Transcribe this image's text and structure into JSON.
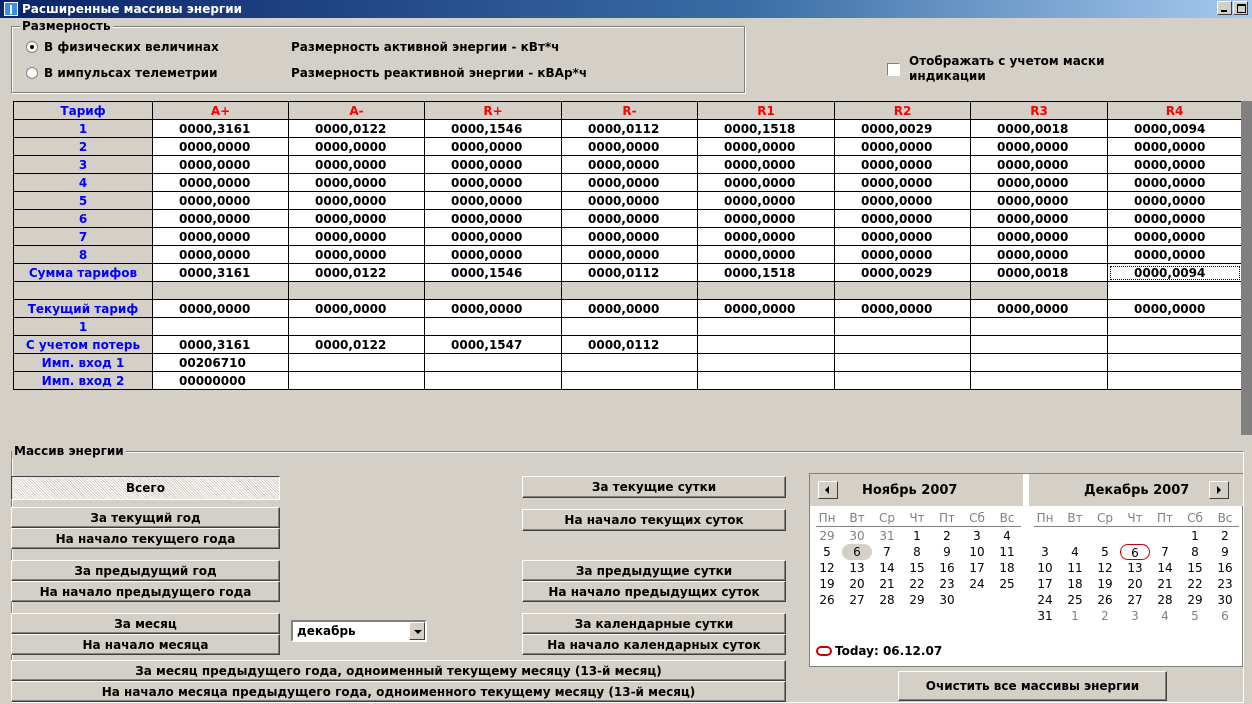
{
  "window": {
    "title": "Расширенные массивы энергии"
  },
  "dimension": {
    "legend": "Размерность",
    "option_physical": "В физических величинах",
    "option_pulses": "В импульсах телеметрии",
    "active_unit": "Размерность активной энергии - кВт*ч",
    "reactive_unit": "Размерность реактивной энергии - кВАр*ч",
    "mask_checkbox_line1": "Отображать с учетом маски",
    "mask_checkbox_line2": "индикации",
    "mask_checked": false
  },
  "grid": {
    "headers": [
      "Тариф",
      "A+",
      "A-",
      "R+",
      "R-",
      "R1",
      "R2",
      "R3",
      "R4"
    ],
    "rows": [
      {
        "label": "1",
        "cells": [
          "0000,3161",
          "0000,0122",
          "0000,1546",
          "0000,0112",
          "0000,1518",
          "0000,0029",
          "0000,0018",
          "0000,0094"
        ]
      },
      {
        "label": "2",
        "cells": [
          "0000,0000",
          "0000,0000",
          "0000,0000",
          "0000,0000",
          "0000,0000",
          "0000,0000",
          "0000,0000",
          "0000,0000"
        ]
      },
      {
        "label": "3",
        "cells": [
          "0000,0000",
          "0000,0000",
          "0000,0000",
          "0000,0000",
          "0000,0000",
          "0000,0000",
          "0000,0000",
          "0000,0000"
        ]
      },
      {
        "label": "4",
        "cells": [
          "0000,0000",
          "0000,0000",
          "0000,0000",
          "0000,0000",
          "0000,0000",
          "0000,0000",
          "0000,0000",
          "0000,0000"
        ]
      },
      {
        "label": "5",
        "cells": [
          "0000,0000",
          "0000,0000",
          "0000,0000",
          "0000,0000",
          "0000,0000",
          "0000,0000",
          "0000,0000",
          "0000,0000"
        ]
      },
      {
        "label": "6",
        "cells": [
          "0000,0000",
          "0000,0000",
          "0000,0000",
          "0000,0000",
          "0000,0000",
          "0000,0000",
          "0000,0000",
          "0000,0000"
        ]
      },
      {
        "label": "7",
        "cells": [
          "0000,0000",
          "0000,0000",
          "0000,0000",
          "0000,0000",
          "0000,0000",
          "0000,0000",
          "0000,0000",
          "0000,0000"
        ]
      },
      {
        "label": "8",
        "cells": [
          "0000,0000",
          "0000,0000",
          "0000,0000",
          "0000,0000",
          "0000,0000",
          "0000,0000",
          "0000,0000",
          "0000,0000"
        ]
      },
      {
        "label": "Сумма тарифов",
        "cells": [
          "0000,3161",
          "0000,0122",
          "0000,1546",
          "0000,0112",
          "0000,1518",
          "0000,0029",
          "0000,0018",
          "0000,0094"
        ]
      },
      {
        "label": "",
        "cells": [
          "",
          "",
          "",
          "",
          "",
          "",
          "",
          ""
        ]
      },
      {
        "label": "Текущий тариф",
        "cells": [
          "0000,0000",
          "0000,0000",
          "0000,0000",
          "0000,0000",
          "0000,0000",
          "0000,0000",
          "0000,0000",
          "0000,0000"
        ]
      },
      {
        "label": "1",
        "cells": [
          "",
          "",
          "",
          "",
          "",
          "",
          "",
          ""
        ]
      },
      {
        "label": "С учетом потерь",
        "cells": [
          "0000,3161",
          "0000,0122",
          "0000,1547",
          "0000,0112",
          "",
          "",
          "",
          ""
        ]
      },
      {
        "label": "Имп. вход 1",
        "cells": [
          "00206710",
          "",
          "",
          "",
          "",
          "",
          "",
          ""
        ]
      },
      {
        "label": "Имп. вход 2",
        "cells": [
          "00000000",
          "",
          "",
          "",
          "",
          "",
          "",
          ""
        ]
      }
    ]
  },
  "energy": {
    "legend": "Массив энергии",
    "total": "Всего",
    "current_year": "За текущий год",
    "start_current_year": "На начало текущего года",
    "previous_year": "За предыдущий год",
    "start_previous_year": "На начало предыдущего года",
    "month": "За месяц",
    "start_month": "На начало месяца",
    "month_select": "декабрь",
    "current_day": "За текущие сутки",
    "start_current_day": "На начало текущих суток",
    "previous_day": "За предыдущие сутки",
    "start_previous_day": "На начало предыдущих суток",
    "calendar_day": "За календарные сутки",
    "start_calendar_day": "На начало календарных суток",
    "month_prev_year": "За месяц предыдущего года, одноименный текущему месяцу (13-й месяц)",
    "start_month_prev_year": "На начало месяца предыдущего года, одноименного текущему месяцу (13-й месяц)",
    "clear_all": "Очистить все массивы энергии"
  },
  "calendar": {
    "left_title": "Ноябрь 2007",
    "right_title": "Декабрь 2007",
    "dow": [
      "Пн",
      "Вт",
      "Ср",
      "Чт",
      "Пт",
      "Сб",
      "Вс"
    ],
    "november": [
      [
        "29",
        "30",
        "31",
        "1",
        "2",
        "3",
        "4"
      ],
      [
        "5",
        "6",
        "7",
        "8",
        "9",
        "10",
        "11"
      ],
      [
        "12",
        "13",
        "14",
        "15",
        "16",
        "17",
        "18"
      ],
      [
        "19",
        "20",
        "21",
        "22",
        "23",
        "24",
        "25"
      ],
      [
        "26",
        "27",
        "28",
        "29",
        "30",
        "",
        ""
      ]
    ],
    "december": [
      [
        "",
        "",
        "",
        "",
        "",
        "1",
        "2"
      ],
      [
        "3",
        "4",
        "5",
        "6",
        "7",
        "8",
        "9"
      ],
      [
        "10",
        "11",
        "12",
        "13",
        "14",
        "15",
        "16"
      ],
      [
        "17",
        "18",
        "19",
        "20",
        "21",
        "22",
        "23"
      ],
      [
        "24",
        "25",
        "26",
        "27",
        "28",
        "29",
        "30"
      ],
      [
        "31",
        "1",
        "2",
        "3",
        "4",
        "5",
        "6"
      ]
    ],
    "today_label": "Today: 06.12.07"
  },
  "colors": {
    "header_blue": "#0000ff",
    "header_red": "#ff0000",
    "face": "#d4d0c8"
  }
}
